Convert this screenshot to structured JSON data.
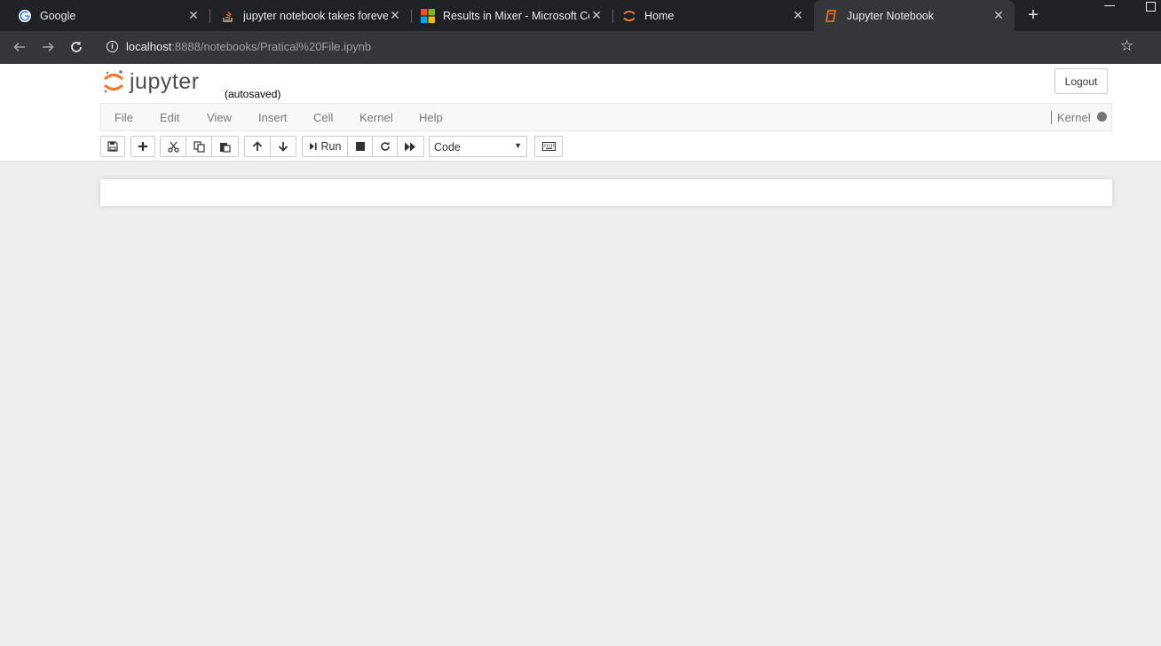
{
  "browser": {
    "tabs": [
      {
        "title": "Google",
        "icon": "google-icon",
        "active": false
      },
      {
        "title": "jupyter notebook takes forever",
        "icon": "stackoverflow-icon",
        "active": false
      },
      {
        "title": "Results in Mixer - Microsoft Co",
        "icon": "microsoft-icon",
        "active": false
      },
      {
        "title": "Home",
        "icon": "jupyter-icon",
        "active": false
      },
      {
        "title": "Jupyter Notebook",
        "icon": "notebook-icon",
        "active": true
      }
    ],
    "url_host": "localhost",
    "url_path": ":8888/notebooks/Pratical%20File.ipynb"
  },
  "jupyter": {
    "logo_text": "jupyter",
    "autosave": "(autosaved)",
    "logout_label": "Logout",
    "menu": [
      "File",
      "Edit",
      "View",
      "Insert",
      "Cell",
      "Kernel",
      "Help"
    ],
    "kernel_indicator": "Kernel",
    "toolbar": {
      "run_label": "Run",
      "cell_type": "Code"
    }
  },
  "colors": {
    "tab_bar": "#202124",
    "address_bar": "#35363a",
    "jupyter_orange": "#f37726",
    "page_background": "#eeeeee"
  }
}
